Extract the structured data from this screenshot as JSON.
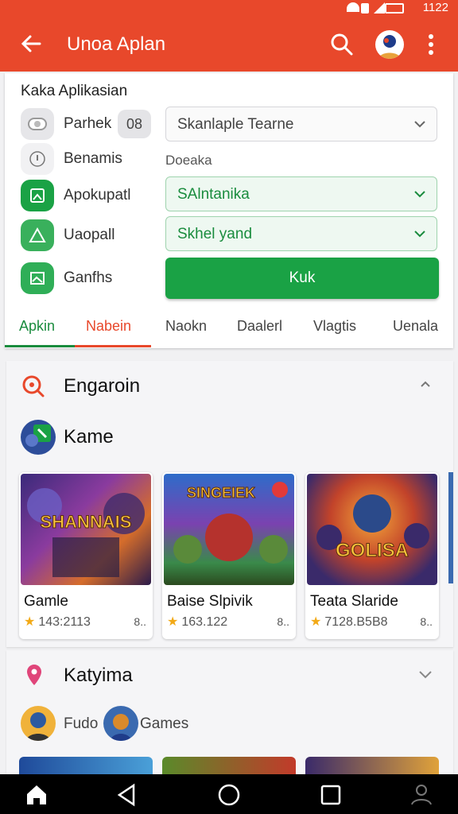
{
  "status": {
    "time": "1122"
  },
  "appbar": {
    "title": "Unoa Aplan"
  },
  "panel": {
    "heading": "Kaka Aplikasian",
    "categories": [
      {
        "label": "Parhek"
      },
      {
        "label": "Benamis"
      },
      {
        "label": "Apokupatl"
      },
      {
        "label": "Uaopall"
      },
      {
        "label": "Ganfhs"
      }
    ],
    "badge": "08",
    "select_top": "Skanlaple Tearne",
    "desc_label": "Doeaka",
    "select_green1": "SAlntanika",
    "select_green2": "Skhel yand",
    "button": "Kuk",
    "tabs": [
      "Apkin",
      "Nabein",
      "Naokn",
      "Daalerl",
      "Vlagtis",
      "Uenala"
    ]
  },
  "section1": {
    "title": "Engaroin",
    "subtitle": "Kame",
    "games": [
      {
        "name": "Gamle",
        "rating": "143:2113",
        "side": "8..",
        "art_text": "SHANNAIS"
      },
      {
        "name": "Baise Slpivik",
        "rating": "163.122",
        "side": "8..",
        "art_text": "SINGEIEK"
      },
      {
        "name": "Teata Slaride",
        "rating": "7128.B5B8",
        "side": "8..",
        "art_text": "GOLISA"
      }
    ]
  },
  "section2": {
    "title": "Katyima",
    "chip1": "Fudo",
    "chip2": "Games"
  },
  "colors": {
    "brand": "#e8482b",
    "green": "#1aa245"
  }
}
